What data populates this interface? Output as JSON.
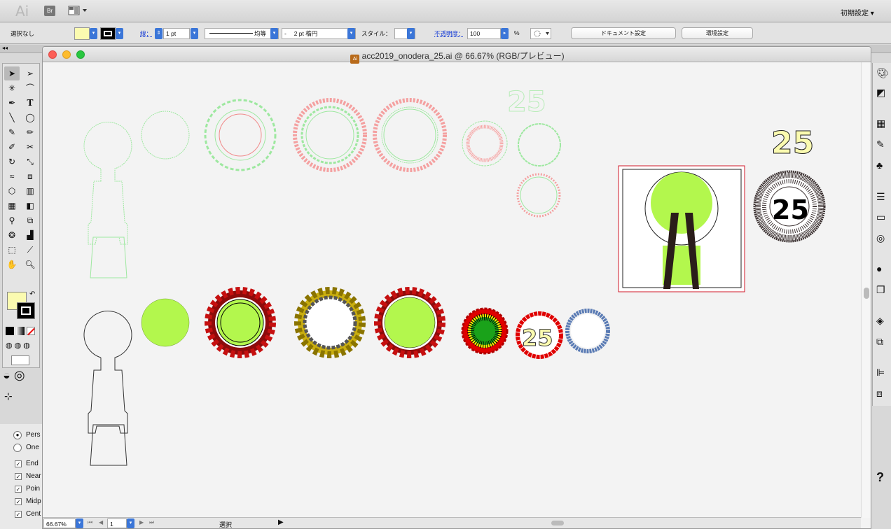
{
  "app": {
    "logo": "Ai",
    "bridge": "Br",
    "workspace": "初期設定 ▾"
  },
  "control": {
    "selection": "選択なし",
    "stroke_label": "線：",
    "stroke_weight": "1 pt",
    "stroke_profile": "均等",
    "brush": "- 　2 pt 楕円",
    "style_label": "スタイル：",
    "opacity_label": "不透明度：",
    "opacity_value": "100",
    "opacity_unit": "%",
    "doc_setup": "ドキュメント設定",
    "prefs": "環境設定",
    "fill_color": "#fbfbb0",
    "accent": "#3b76d8"
  },
  "document": {
    "title": "acc2019_onodera_25.ai @ 66.67% (RGB/プレビュー)"
  },
  "status": {
    "zoom": "66.67%",
    "artboard": "1",
    "tool": "選択"
  },
  "panel3d": {
    "radio": [
      "Pers",
      "One"
    ],
    "checks": [
      "End",
      "Near",
      "Poin",
      "Midp",
      "Cent"
    ]
  },
  "art": {
    "number": "25"
  }
}
